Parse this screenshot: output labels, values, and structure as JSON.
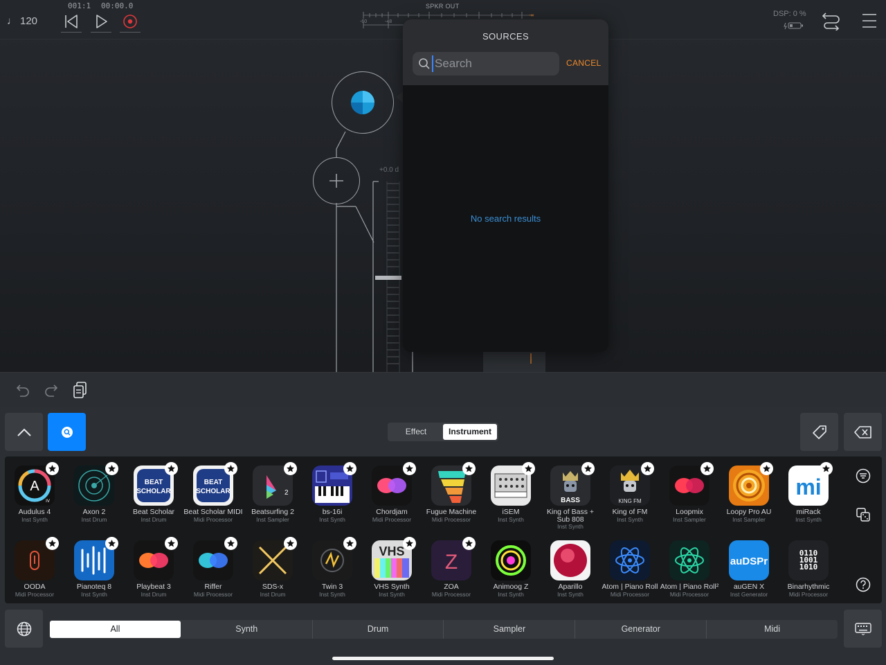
{
  "topbar": {
    "tempo": "120",
    "position": "001:1",
    "time": "00:00.0",
    "output_label": "SPKR OUT",
    "meter_ticks": [
      "-60",
      "-48",
      "-∞"
    ],
    "dsp": "DSP: 0 %"
  },
  "graph": {
    "gain_label": "+0.0 d"
  },
  "sources_popup": {
    "title": "SOURCES",
    "search_placeholder": "Search",
    "cancel_label": "CANCEL",
    "empty_message": "No search results"
  },
  "browser": {
    "mode_tabs": [
      "Effect",
      "Instrument"
    ],
    "active_mode": "Instrument",
    "plugins_row1": [
      {
        "name": "Audulus 4",
        "kind": "Inst Synth"
      },
      {
        "name": "Axon 2",
        "kind": "Inst Drum"
      },
      {
        "name": "Beat Scholar",
        "kind": "Inst Drum"
      },
      {
        "name": "Beat Scholar MIDI",
        "kind": "Midi Processor"
      },
      {
        "name": "Beatsurfing 2",
        "kind": "Inst Sampler"
      },
      {
        "name": "bs-16i",
        "kind": "Inst Synth"
      },
      {
        "name": "Chordjam",
        "kind": "Midi Processor"
      },
      {
        "name": "Fugue Machine",
        "kind": "Midi Processor"
      },
      {
        "name": "iSEM",
        "kind": "Inst Synth"
      },
      {
        "name": "King of Bass + Sub 808",
        "kind": "Inst Synth"
      },
      {
        "name": "King of FM",
        "kind": "Inst Synth"
      },
      {
        "name": "Loopmix",
        "kind": "Inst Sampler"
      },
      {
        "name": "Loopy Pro AU",
        "kind": "Inst Sampler"
      },
      {
        "name": "miRack",
        "kind": "Inst Synth"
      }
    ],
    "plugins_row2": [
      {
        "name": "OODA",
        "kind": "Midi Processor"
      },
      {
        "name": "Pianoteq 8",
        "kind": "Inst Synth"
      },
      {
        "name": "Playbeat 3",
        "kind": "Inst Drum"
      },
      {
        "name": "Riffer",
        "kind": "Midi Processor"
      },
      {
        "name": "SDS-x",
        "kind": "Inst Drum"
      },
      {
        "name": "Twin 3",
        "kind": "Inst Synth"
      },
      {
        "name": "VHS Synth",
        "kind": "Inst Synth"
      },
      {
        "name": "ZOA",
        "kind": "Midi Processor"
      },
      {
        "name": "Animoog Z",
        "kind": "Inst Synth"
      },
      {
        "name": "Aparillo",
        "kind": "Inst Synth"
      },
      {
        "name": "Atom | Piano Roll",
        "kind": "Midi Processor"
      },
      {
        "name": "Atom | Piano Roll²",
        "kind": "Midi Processor"
      },
      {
        "name": "auGEN X",
        "kind": "Inst Generator"
      },
      {
        "name": "Binarhythmic",
        "kind": "Midi Processor"
      }
    ],
    "icon_text": {
      "audulus": "A",
      "audulus_sub": "IV",
      "beat_scholar": "BEAT SCHOLAR",
      "beatsurfing": "2",
      "kob": "BASS",
      "kofm": "KING FM",
      "mirack": "mi",
      "vhs": "VHS",
      "zoa": "Z",
      "augen": "auDSPr",
      "binar": "0110 1001 1010"
    },
    "categories": [
      "All",
      "Synth",
      "Drum",
      "Sampler",
      "Generator",
      "Midi"
    ],
    "active_category": "All"
  }
}
